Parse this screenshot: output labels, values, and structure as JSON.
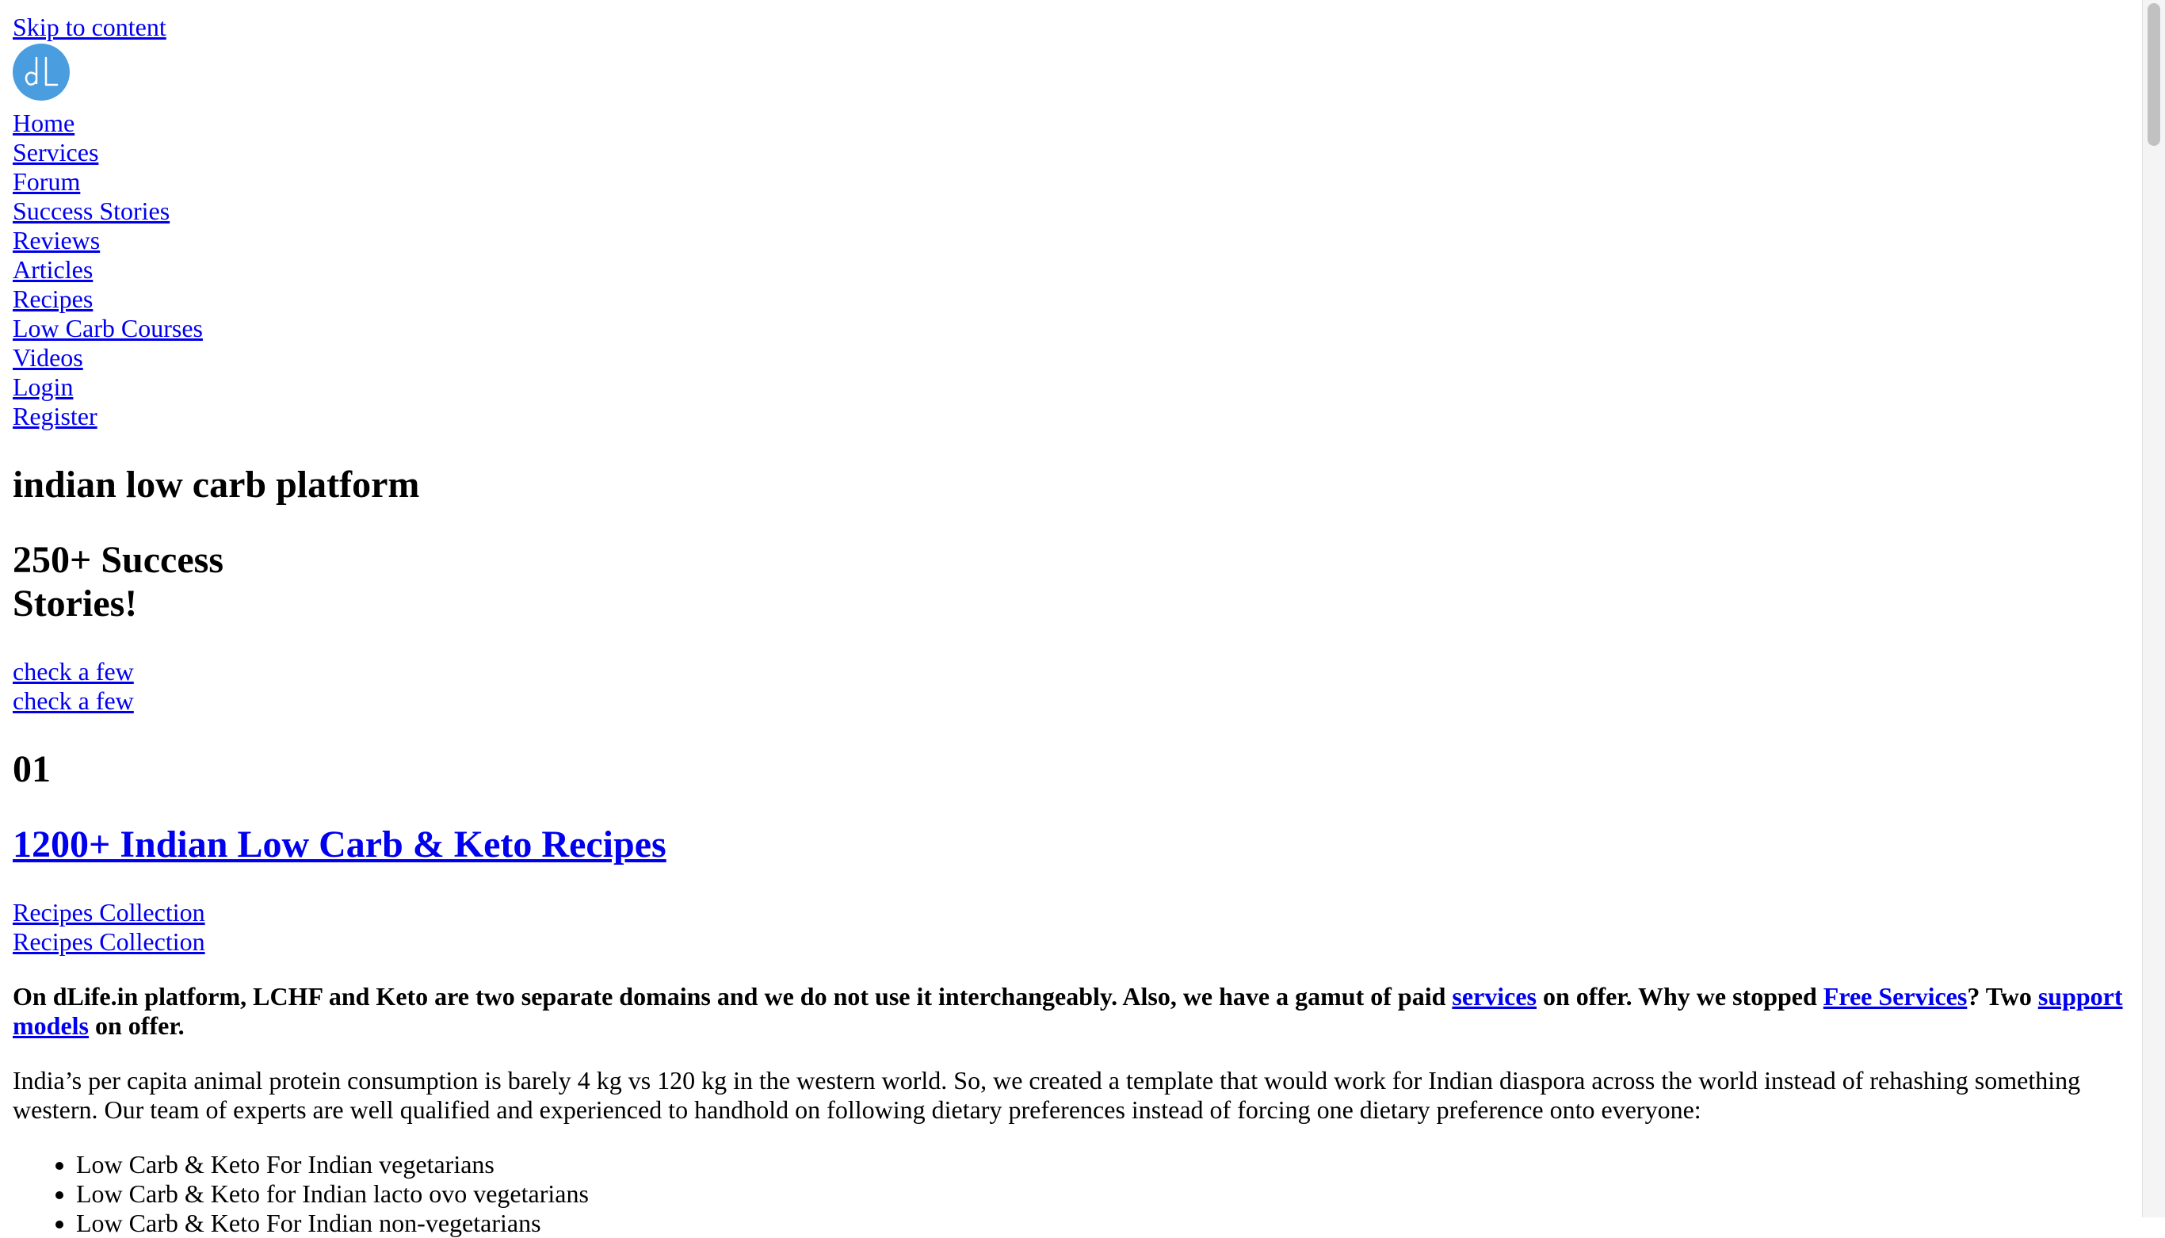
{
  "skip_link": "Skip to content",
  "logo": {
    "text": "dL",
    "color": "#4a9ee0"
  },
  "nav": {
    "items": [
      "Home",
      "Services",
      "Forum",
      "Success Stories",
      "Reviews",
      "Articles",
      "Recipes",
      "Low Carb Courses",
      "Videos",
      "Login",
      "Register"
    ]
  },
  "hero": {
    "title": "indian low carb platform",
    "success_line1": "250+ Success",
    "success_line2": "Stories!",
    "cta_1": "check a few",
    "cta_2": "check a few"
  },
  "section1": {
    "number": "01",
    "heading": "1200+ Indian Low Carb & Keto Recipes",
    "link_1": "Recipes Collection",
    "link_2": "Recipes Collection"
  },
  "intro": {
    "part1": "On dLife.in platform, LCHF and Keto are two separate domains and we do not use it interchangeably. Also, we have a gamut of paid ",
    "link_services": "services",
    "part2": " on offer. Why we stopped ",
    "link_free": "Free Services",
    "part3": "? Two ",
    "link_support": "support models",
    "part4": " on offer."
  },
  "paragraph": "India’s per capita animal protein consumption is barely 4 kg vs 120 kg in the western world. So, we created a template that would work for Indian diaspora across the world instead of rehashing something western. Our team of experts are well qualified and experienced to handhold on following dietary preferences instead of forcing one dietary preference onto everyone:",
  "list": [
    "Low Carb & Keto For Indian vegetarians",
    "Low Carb & Keto for Indian lacto ovo vegetarians",
    "Low Carb & Keto For Indian non-vegetarians"
  ]
}
